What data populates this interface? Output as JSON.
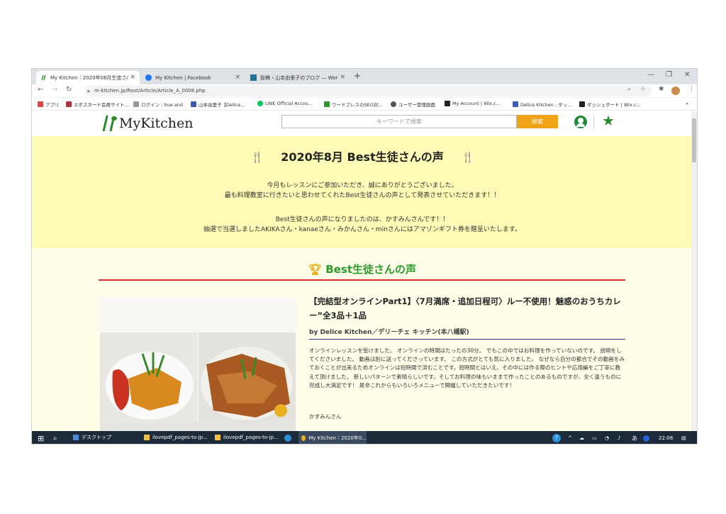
{
  "browser": {
    "tabs": [
      {
        "label": "My Kitchen｜2020年08月生徒さ/",
        "active": true
      },
      {
        "label": "My Kitchen | Facebook",
        "active": false
      },
      {
        "label": "投稿 ‹ 山本由里子のブログ — Wor",
        "active": false
      }
    ],
    "new_tab": "+",
    "close_glyph": "×",
    "url": "m-kitchen.jp/Root/Article/Article_A_0008.php",
    "bookmarks": [
      "アプリ",
      "エポスカード会員サイト...",
      "ログイン｜hue and",
      "山本由里子【Delice...",
      "LINE Official Accou...",
      "ワードプレスのSEO対...",
      "ユーザー管理画面",
      "My Account | Wix.c...",
      "Delice Kitchen - ダッ...",
      "ダッシュボード | Wix.c..."
    ],
    "bookmarks_more": "»"
  },
  "site": {
    "logo_text": "MyKitchen",
    "search_placeholder": "キーワードで検索",
    "search_button": "検索"
  },
  "banner": {
    "title": "2020年8月 Best生徒さんの声",
    "line1": "今月もレッスンにご参加いただき、誠にありがとうございました。",
    "line2": "最も料理教室に行きたいと思わせてくれたBest生徒さんの声として発表させていただきます！！",
    "line3": "Best生徒さんの声になりましたのは、かすみんさんです！！",
    "line4": "抽選で当選しましたAKIKAさん・kanaeさん・みかんさん・minさんにはアマゾンギフト券を贈呈いたします。"
  },
  "section": {
    "heading": "Best生徒さんの声"
  },
  "article": {
    "title": "【完結型オンラインPart1】〈7月満席・追加日程可〉ルー不使用！魅惑のおうちカレー”全3品＋1品",
    "by": "by Delice Kitchen／デリーチェ キッチン(本八幡駅)",
    "body": "オンラインレッスンを受けました。 オンラインの時間はたったの30分。 でもこの中ではお料理を作っていないのです。 説明をしてくださいました。 動画は別に送ってくださっています。 この方式がとても気に入りました。 なぜなら自分の都合でその動画をみておくことが出来るためオンラインは短時間で済むことです。短時間とはいえ、その中には作る際のヒントや応用編をご丁寧に教えて頂けました。 新しいパターンで素晴らしいです。そしてお料理の味もいままで作ったことのあるものですが、全く違うものに完成し大満足です！ 是非これからもいろいろメニューで開催していただきたいです！",
    "author": "かすみんさん"
  },
  "taskbar": {
    "items": [
      "デスクトップ",
      "ilovepdf_pages-to-jp...",
      "ilovepdf_pages-to-jp...",
      "My Kitchen｜2020年0..."
    ],
    "ime": "あ",
    "time": "22:08"
  },
  "colors": {
    "banner_bg": "#fdfbb5",
    "page_bg": "#fdfde8",
    "accent_orange": "#f0a318",
    "heading_green": "#2a9a2a",
    "rule_red": "#d32f2f",
    "taskbar_bg": "#1c2a3a"
  }
}
